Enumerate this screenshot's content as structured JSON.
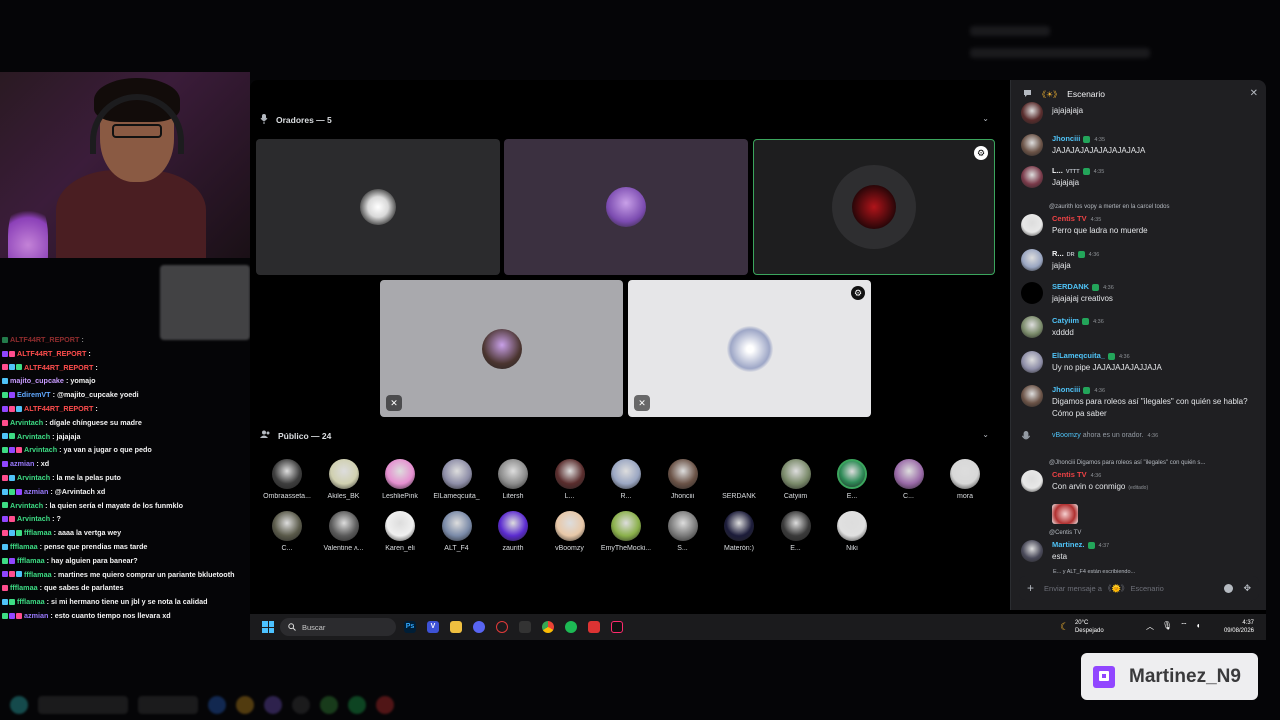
{
  "twitch_chat": [
    {
      "user": "ALTF44RT_REPORT",
      "msg": ":",
      "color": "#ff4d4d",
      "dim": true
    },
    {
      "user": "ALTF44RT_REPORT",
      "msg": ":",
      "color": "#ff4d4d",
      "dim": false
    },
    {
      "user": "ALTF44RT_REPORT",
      "msg": ":",
      "color": "#ff4d4d",
      "dim": false
    },
    {
      "user": "majito_cupcake",
      "msg": ": yomajo",
      "color": "#c89bff",
      "dim": false
    },
    {
      "user": "EdiremVT",
      "msg": ": @majito_cupcake yoedi",
      "color": "#60a8ff",
      "dim": false
    },
    {
      "user": "ALTF44RT_REPORT",
      "msg": ":",
      "color": "#ff4d4d",
      "dim": false
    },
    {
      "user": "Arvintach",
      "msg": ": dígale chínguese su madre",
      "color": "#3ddc84",
      "dim": false
    },
    {
      "user": "Arvintach",
      "msg": ": jajajaja",
      "color": "#3ddc84",
      "dim": false
    },
    {
      "user": "Arvintach",
      "msg": ": ya van a jugar o que pedo",
      "color": "#3ddc84",
      "dim": false
    },
    {
      "user": "azmian",
      "msg": ": xd",
      "color": "#9b7bff",
      "dim": false
    },
    {
      "user": "Arvintach",
      "msg": ": la me la pelas puto",
      "color": "#3ddc84",
      "dim": false
    },
    {
      "user": "azmian",
      "msg": ": @Arvintach xd",
      "color": "#9b7bff",
      "dim": false
    },
    {
      "user": "Arvintach",
      "msg": ": la quien sería el mayate de los funmklo",
      "color": "#3ddc84",
      "dim": false
    },
    {
      "user": "Arvintach",
      "msg": ": ?",
      "color": "#3ddc84",
      "dim": false
    },
    {
      "user": "ffflamaa",
      "msg": ": aaaa la vertga wey",
      "color": "#3ddc84",
      "dim": false
    },
    {
      "user": "ffflamaa",
      "msg": ": pense que prendias mas tarde",
      "color": "#3ddc84",
      "dim": false
    },
    {
      "user": "ffflamaa",
      "msg": ": hay alguien para banear?",
      "color": "#3ddc84",
      "dim": false
    },
    {
      "user": "ffflamaa",
      "msg": ": martines me quiero comprar un pariante bkluetooth",
      "color": "#3ddc84",
      "dim": false
    },
    {
      "user": "ffflamaa",
      "msg": ": que sabes de parlantes",
      "color": "#3ddc84",
      "dim": false
    },
    {
      "user": "ffflamaa",
      "msg": ": si mi hermano tiene un jbl y se nota la calidad",
      "color": "#3ddc84",
      "dim": false
    },
    {
      "user": "azmian",
      "msg": ": esto cuanto tiempo nos llevara xd",
      "color": "#9b7bff",
      "dim": false
    }
  ],
  "stage": {
    "speakers_label": "Oradores — 5",
    "audience_label": "Público — 24",
    "speakers": [
      {
        "id": "s1",
        "bg": "#2b2b2d",
        "avatar_color": "#d9d9d9",
        "speaking": false
      },
      {
        "id": "s2",
        "bg": "#3b3040",
        "avatar_color": "#7b4bb0",
        "speaking": false
      },
      {
        "id": "s3",
        "bg": "#1e1e1f",
        "avatar_color": "#b0141a",
        "speaking": true
      },
      {
        "id": "s4",
        "bg": "#a9a9ad",
        "avatar_color": "#4b3530",
        "speaking": false
      },
      {
        "id": "s5",
        "bg": "#e6e6e8",
        "avatar_color": "#9ea7c7",
        "speaking": false
      }
    ],
    "audience": [
      {
        "name": "Ombraasseta...",
        "color": "#3d3d3d"
      },
      {
        "name": "Akiles_BK",
        "color": "#d0d0b0"
      },
      {
        "name": "LeshliePink",
        "color": "#e58fd0"
      },
      {
        "name": "ElLameqcuita_",
        "color": "#8e8ea8"
      },
      {
        "name": "Litersh",
        "color": "#8c8c8c"
      },
      {
        "name": "L...",
        "color": "#5a2d2d"
      },
      {
        "name": "R...",
        "color": "#9aa6c2"
      },
      {
        "name": "Jhonciii",
        "color": "#6b5347"
      },
      {
        "name": "SERDANK",
        "color": "#f5e23a"
      },
      {
        "name": "Catyiim",
        "color": "#7a8a6a"
      },
      {
        "name": "E...",
        "color": "#2e8b57"
      },
      {
        "name": "C...",
        "color": "#9a6aa8"
      },
      {
        "name": "mora",
        "color": "#d8d8d8"
      },
      {
        "name": "C...",
        "color": "#5a5a4a"
      },
      {
        "name": "Valentine ʌ...",
        "color": "#5a5a5a"
      },
      {
        "name": "Karen_eli",
        "color": "#f0f0f0"
      },
      {
        "name": "ALT_F4",
        "color": "#7a8aa8"
      },
      {
        "name": "zaurith",
        "color": "#5b2bd0"
      },
      {
        "name": "vBoomzy",
        "color": "#e8c8a8"
      },
      {
        "name": "EmyTheMocki...",
        "color": "#8ab04a"
      },
      {
        "name": "S...",
        "color": "#7a7a7a"
      },
      {
        "name": "Materón:)",
        "color": "#1c1c3a"
      },
      {
        "name": "E...",
        "color": "#3a3a3a"
      },
      {
        "name": "Niki",
        "color": "#e0e0e0"
      }
    ]
  },
  "side": {
    "title": "Escenario",
    "close_glyph": "✕",
    "composer_placeholder": "Enviar mensaje a 《🌞》 Escenario",
    "typing": "E... y ALT_F4 están escribiendo...",
    "messages": [
      {
        "type": "msg",
        "user": "",
        "color": "#c89bff",
        "time": "",
        "text": "jajajajaja",
        "av": "#5a2d2d"
      },
      {
        "type": "msg",
        "user": "Jhonciii",
        "color": "#4fc3f7",
        "time": "4:35",
        "text": "JAJAJAJAJAJAJAJAJAJA",
        "av": "#6b5347"
      },
      {
        "type": "msg",
        "user": "L...",
        "color": "#f2f3f5",
        "time": "4:35",
        "text": "Jajajaja",
        "av": "#7a3a4a",
        "tag": "VTTT"
      },
      {
        "type": "reply",
        "reply": "@zaurith los vopy a merter en la carcel todos",
        "user": "Centis TV",
        "color": "#ed4245",
        "time": "4:35",
        "text": "Perro que ladra no muerde",
        "av": "#e8e8e8"
      },
      {
        "type": "msg",
        "user": "R...",
        "color": "#f2f3f5",
        "time": "4:36",
        "text": "jajaja",
        "av": "#9aa6c2",
        "tag": "DR"
      },
      {
        "type": "msg",
        "user": "SERDANK",
        "color": "#4fc3f7",
        "time": "4:36",
        "text": "jajajajaj creativos",
        "av": "#111111"
      },
      {
        "type": "msg",
        "user": "Catyiim",
        "color": "#4fc3f7",
        "time": "4:36",
        "text": "xdddd",
        "av": "#7a8a6a"
      },
      {
        "type": "msg",
        "user": "ElLameqcuita_",
        "color": "#4fc3f7",
        "time": "4:36",
        "text": "Uy no pipe JAJAJAJAJAJJAJA",
        "av": "#8e8ea8"
      },
      {
        "type": "msg2",
        "user": "Jhonciii",
        "color": "#4fc3f7",
        "time": "4:36",
        "text": "Digamos para roleos así \"ilegales\" con quién se habla?",
        "text2": "Cómo pa saber",
        "av": "#6b5347"
      },
      {
        "type": "sys",
        "user": "vBoomzy",
        "color": "#4fc3f7",
        "text": "ahora es un orador.",
        "time": "4:36"
      },
      {
        "type": "reply",
        "reply": "@Jhonciii Digamos para roleos así \"ilegales\" con quién s...",
        "user": "Centis TV",
        "color": "#ed4245",
        "time": "4:36",
        "text": "Con arvin o conmigo",
        "edited": "(editado)",
        "av": "#e8e8e8"
      },
      {
        "type": "reply2",
        "reply": "@Centis TV",
        "user": "Martinez.",
        "color": "#4fc3f7",
        "time": "4:37",
        "text": "esta",
        "av": "#4a4a5a"
      }
    ]
  },
  "taskbar": {
    "search_placeholder": "Buscar",
    "weather_temp": "20°C",
    "weather_desc": "Despejado",
    "time": "4:37",
    "date": "09/08/2026"
  },
  "twitch_name": "Martinez_N9"
}
